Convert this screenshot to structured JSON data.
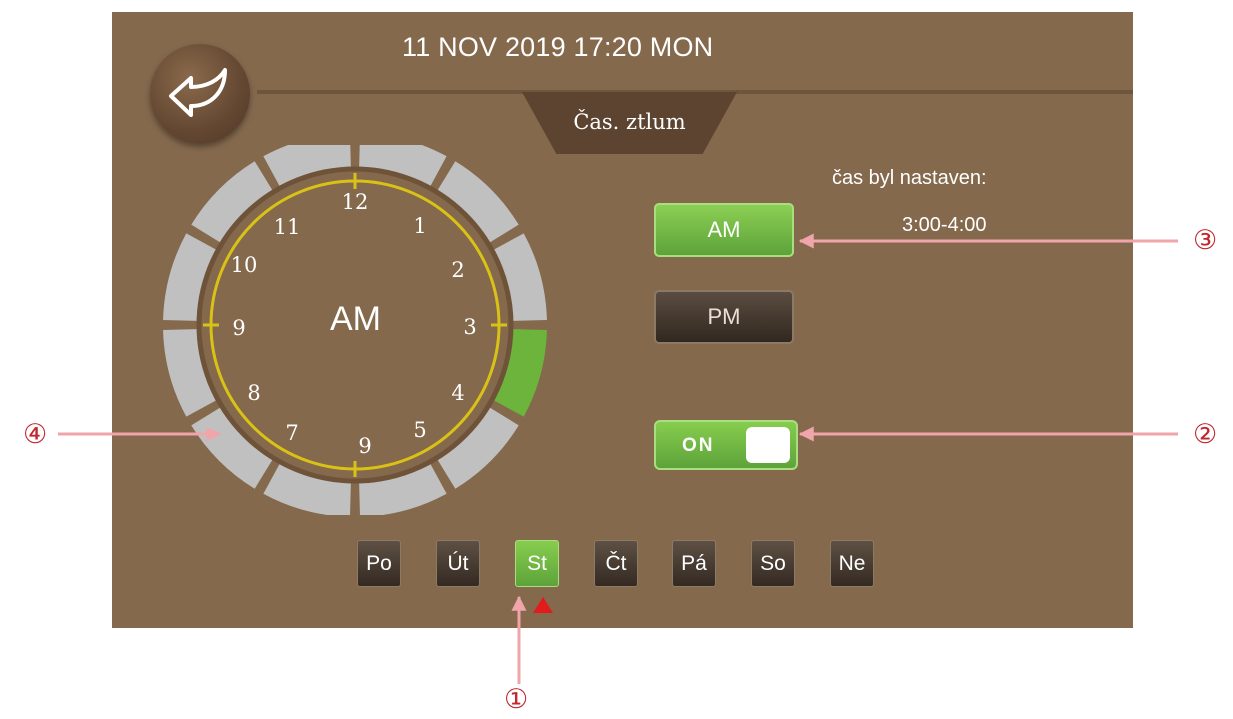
{
  "header": {
    "datetime": "11 NOV 2019 17:20 MON",
    "tab_label": "Čas. ztlum"
  },
  "back_button": {
    "icon": "back-arrow-icon"
  },
  "clock": {
    "ampm_label": "AM",
    "numbers": [
      "12",
      "1",
      "2",
      "3",
      "4",
      "5",
      "9",
      "7",
      "8",
      "9",
      "10",
      "11"
    ],
    "segments": 12,
    "active_hours": [
      3
    ],
    "ring_color": "#c0c0c0",
    "active_color": "#6cb43c",
    "dial_color": "#d9c215"
  },
  "schedule": {
    "title": "čas byl nastaven:",
    "range": "3:00-4:00"
  },
  "period_buttons": {
    "am": "AM",
    "pm": "PM",
    "selected": "AM"
  },
  "toggle": {
    "label": "ON",
    "state": true
  },
  "days": [
    {
      "label": "Po",
      "active": false
    },
    {
      "label": "Út",
      "active": false
    },
    {
      "label": "St",
      "active": true
    },
    {
      "label": "Čt",
      "active": false
    },
    {
      "label": "Pá",
      "active": false
    },
    {
      "label": "So",
      "active": false
    },
    {
      "label": "Ne",
      "active": false
    }
  ],
  "callouts": [
    "①",
    "②",
    "③",
    "④"
  ],
  "colors": {
    "background": "#84694d",
    "accent_green": "#6cb43c",
    "marker_red": "#e21b1b",
    "callout_red": "#c1272d"
  }
}
